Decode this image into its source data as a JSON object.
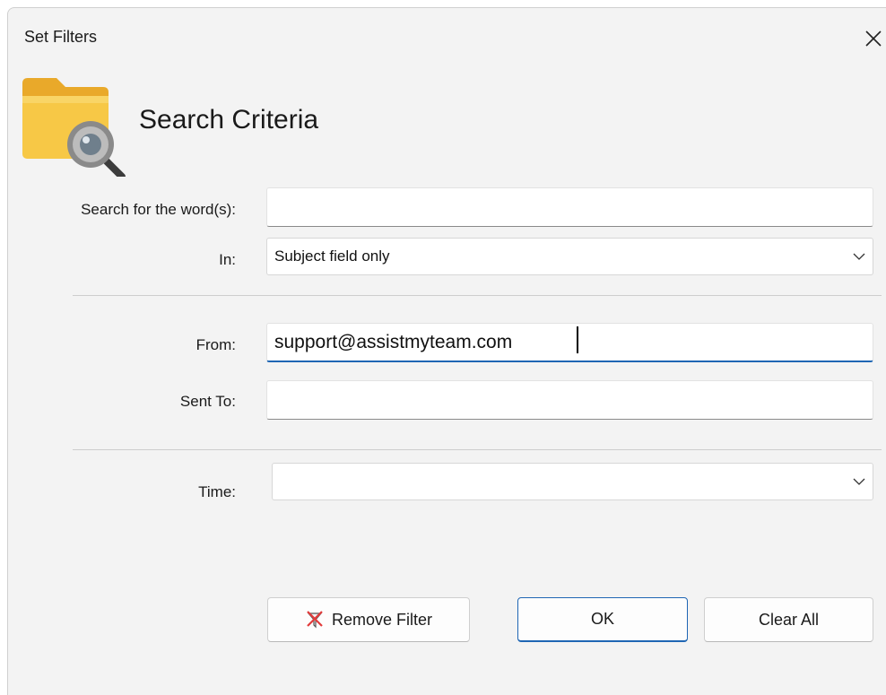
{
  "window": {
    "title": "Set Filters"
  },
  "header": {
    "heading": "Search Criteria",
    "icon": "folder-search-icon"
  },
  "form": {
    "search_label": "Search for the word(s):",
    "search_value": "",
    "in_label": "In:",
    "in_value": "Subject field only",
    "from_label": "From:",
    "from_value": "support@assistmyteam.com",
    "sent_to_label": "Sent To:",
    "sent_to_value": "",
    "time_label": "Time:",
    "time_value": ""
  },
  "buttons": {
    "remove_filter": "Remove Filter",
    "ok": "OK",
    "clear_all": "Clear All"
  },
  "colors": {
    "accent": "#1f66b4",
    "folder": "#f7c846",
    "dialog_bg": "#f3f3f3"
  }
}
